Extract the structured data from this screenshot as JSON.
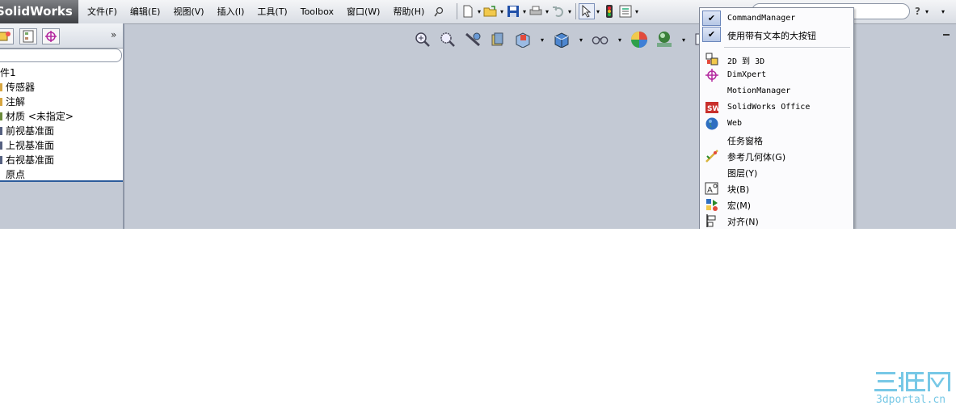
{
  "app": {
    "brand": "SolidWorks"
  },
  "menu": {
    "items": [
      "文件(F)",
      "编辑(E)",
      "视图(V)",
      "插入(I)",
      "工具(T)",
      "Toolbox",
      "窗口(W)",
      "帮助(H)"
    ]
  },
  "toolbar": {
    "icons": [
      "pin-icon",
      "new-document-icon",
      "open-icon",
      "save-icon",
      "print-icon",
      "undo-icon",
      "select-icon",
      "rebuild-icon",
      "options-icon"
    ],
    "help_label": "?"
  },
  "feature_tree": {
    "tabs": [
      "feature-manager-icon",
      "property-manager-icon",
      "dimxpert-manager-icon"
    ],
    "expand_label": "»",
    "items": [
      {
        "label": "件1",
        "marker_color": ""
      },
      {
        "label": "传感器",
        "marker_color": "#d8a640"
      },
      {
        "label": "注解",
        "marker_color": "#d8a640"
      },
      {
        "label": "材质 <未指定>",
        "marker_color": "#6a8a3a"
      },
      {
        "label": "前视基准面",
        "marker_color": "#556080"
      },
      {
        "label": "上视基准面",
        "marker_color": "#556080"
      },
      {
        "label": "右视基准面",
        "marker_color": "#556080"
      },
      {
        "label": "原点",
        "marker_color": ""
      }
    ]
  },
  "view_toolbar": {
    "icons": [
      "zoom-to-fit-icon",
      "zoom-to-area-icon",
      "previous-view-icon",
      "section-view-icon",
      "view-orientation-icon",
      "display-style-icon",
      "hide-show-items-icon",
      "edit-appearance-icon",
      "apply-scene-icon",
      "view-settings-icon"
    ]
  },
  "context_menu": {
    "items": [
      {
        "label": "CommandManager",
        "checked": true,
        "icon": "check-icon"
      },
      {
        "label": "使用带有文本的大按钮",
        "checked": true,
        "icon": "check-icon"
      },
      {
        "label": "2D 到 3D",
        "checked": false,
        "icon": "2d-to-3d-icon"
      },
      {
        "label": "DimXpert",
        "checked": false,
        "icon": "dimxpert-icon"
      },
      {
        "label": "MotionManager",
        "checked": false,
        "icon": "motion-manager-icon"
      },
      {
        "label": "SolidWorks Office",
        "checked": false,
        "icon": "solidworks-office-icon"
      },
      {
        "label": "Web",
        "checked": false,
        "icon": "web-globe-icon"
      },
      {
        "label": "任务窗格",
        "checked": false,
        "icon": ""
      },
      {
        "label": "参考几何体(G)",
        "checked": false,
        "icon": "reference-geometry-icon"
      },
      {
        "label": "图层(Y)",
        "checked": false,
        "icon": ""
      },
      {
        "label": "块(B)",
        "checked": false,
        "icon": "block-icon"
      },
      {
        "label": "宏(M)",
        "checked": false,
        "icon": "macro-icon"
      },
      {
        "label": "对齐(N)",
        "checked": false,
        "icon": "align-icon"
      }
    ]
  },
  "watermark": {
    "logo_text": "三维网",
    "site": "3dportal.cn"
  },
  "colors": {
    "graphics_bg": "#c3c9d4",
    "menu_highlight": "#b6c7e6",
    "watermark": "#77c8e6"
  }
}
